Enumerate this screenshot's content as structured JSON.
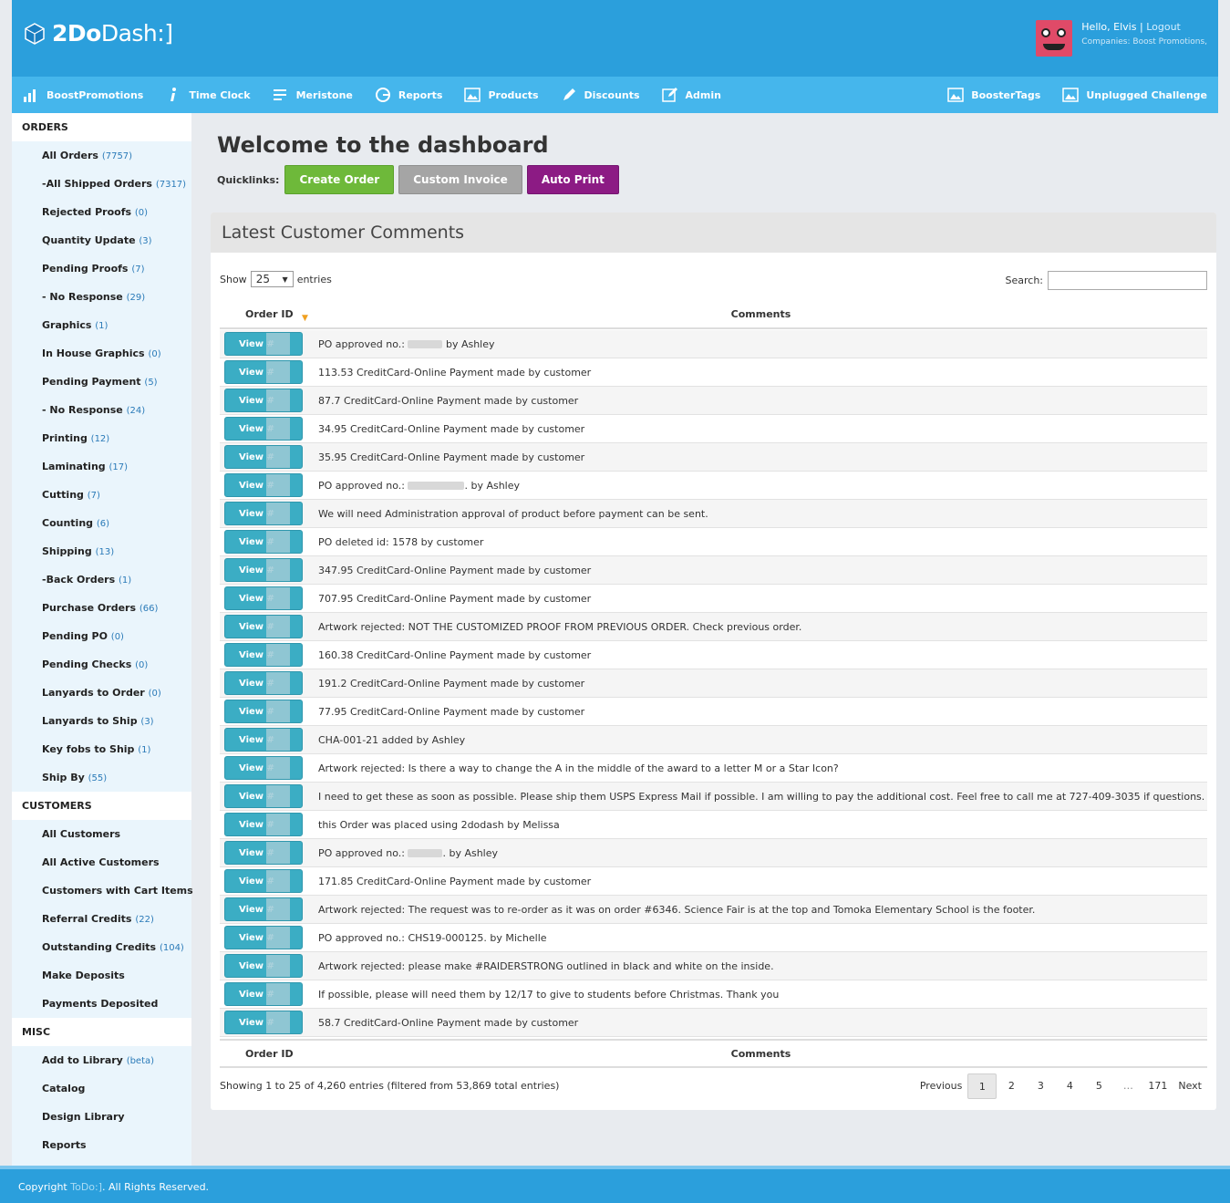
{
  "brand": {
    "name_bold": "2Do",
    "name_light": "Dash:]"
  },
  "user": {
    "greeting": "Hello, Elvis",
    "separator": "|",
    "logout": "Logout",
    "companies": "Companies: Boost Promotions,"
  },
  "nav": [
    {
      "label": "BoostPromotions",
      "icon": "bar-chart-icon"
    },
    {
      "label": "Time Clock",
      "icon": "info-icon"
    },
    {
      "label": "Meristone",
      "icon": "list-icon"
    },
    {
      "label": "Reports",
      "icon": "reports-icon"
    },
    {
      "label": "Products",
      "icon": "image-icon"
    },
    {
      "label": "Discounts",
      "icon": "pen-icon"
    },
    {
      "label": "Admin",
      "icon": "edit-icon"
    }
  ],
  "nav_right": [
    {
      "label": "BoosterTags",
      "icon": "image-icon"
    },
    {
      "label": "Unplugged Challenge",
      "icon": "image-icon"
    }
  ],
  "sidebar": {
    "orders_title": "ORDERS",
    "orders": [
      {
        "label": "All Orders",
        "count": "(7757)"
      },
      {
        "label": "-All Shipped Orders",
        "count": "(7317)"
      },
      {
        "label": "Rejected Proofs",
        "count": "(0)"
      },
      {
        "label": "Quantity Update",
        "count": "(3)"
      },
      {
        "label": "Pending Proofs",
        "count": "(7)"
      },
      {
        "label": "- No Response",
        "count": "(29)"
      },
      {
        "label": "Graphics",
        "count": "(1)"
      },
      {
        "label": "In House Graphics",
        "count": "(0)"
      },
      {
        "label": "Pending Payment",
        "count": "(5)"
      },
      {
        "label": "- No Response",
        "count": "(24)"
      },
      {
        "label": "Printing",
        "count": "(12)"
      },
      {
        "label": "Laminating",
        "count": "(17)"
      },
      {
        "label": "Cutting",
        "count": "(7)"
      },
      {
        "label": "Counting",
        "count": "(6)"
      },
      {
        "label": "Shipping",
        "count": "(13)"
      },
      {
        "label": "-Back Orders",
        "count": "(1)"
      },
      {
        "label": "Purchase Orders",
        "count": "(66)"
      },
      {
        "label": "Pending PO",
        "count": "(0)"
      },
      {
        "label": "Pending Checks",
        "count": "(0)"
      },
      {
        "label": "Lanyards to Order",
        "count": "(0)"
      },
      {
        "label": "Lanyards to Ship",
        "count": "(3)"
      },
      {
        "label": "Key fobs to Ship",
        "count": "(1)"
      },
      {
        "label": "Ship By",
        "count": "(55)"
      }
    ],
    "customers_title": "CUSTOMERS",
    "customers": [
      {
        "label": "All Customers",
        "count": ""
      },
      {
        "label": "All Active Customers",
        "count": ""
      },
      {
        "label": "Customers with Cart Items",
        "count": ""
      },
      {
        "label": "Referral Credits",
        "count": "(22)"
      },
      {
        "label": "Outstanding Credits",
        "count": "(104)"
      },
      {
        "label": "Make Deposits",
        "count": ""
      },
      {
        "label": "Payments Deposited",
        "count": ""
      }
    ],
    "misc_title": "MISC",
    "misc": [
      {
        "label": "Add to Library",
        "count": "(beta)"
      },
      {
        "label": "Catalog",
        "count": ""
      },
      {
        "label": "Design Library",
        "count": ""
      },
      {
        "label": "Reports",
        "count": ""
      }
    ]
  },
  "main": {
    "title": "Welcome to the dashboard",
    "quicklinks_label": "Quicklinks:",
    "quicklinks": {
      "create": "Create Order",
      "invoice": "Custom Invoice",
      "print": "Auto Print"
    }
  },
  "comments_panel": {
    "title": "Latest Customer Comments",
    "show_label": "Show",
    "show_value": "25",
    "entries_label": "entries",
    "search_label": "Search:",
    "search_value": "",
    "col_order": "Order ID",
    "col_comments": "Comments",
    "view_label": "View #",
    "rows": [
      {
        "pre": "PO approved no.: ",
        "redact": 38,
        "post": " by Ashley"
      },
      {
        "pre": "113.53 CreditCard-Online Payment made by customer"
      },
      {
        "pre": "87.7 CreditCard-Online Payment made by customer"
      },
      {
        "pre": "34.95 CreditCard-Online Payment made by customer"
      },
      {
        "pre": "35.95 CreditCard-Online Payment made by customer"
      },
      {
        "pre": "PO approved no.: ",
        "redact": 62,
        "post": ". by Ashley"
      },
      {
        "pre": "We will need Administration approval of product before payment can be sent."
      },
      {
        "pre": "PO deleted id: 1578 by customer"
      },
      {
        "pre": "347.95 CreditCard-Online Payment made by customer"
      },
      {
        "pre": "707.95 CreditCard-Online Payment made by customer"
      },
      {
        "pre": "Artwork rejected: NOT THE CUSTOMIZED PROOF FROM PREVIOUS ORDER. Check previous order."
      },
      {
        "pre": "160.38 CreditCard-Online Payment made by customer"
      },
      {
        "pre": "191.2 CreditCard-Online Payment made by customer"
      },
      {
        "pre": "77.95 CreditCard-Online Payment made by customer"
      },
      {
        "pre": "CHA-001-21 added by Ashley"
      },
      {
        "pre": "Artwork rejected: Is there a way to change the A in the middle of the award to a letter M or a Star Icon?"
      },
      {
        "pre": "I need to get these as soon as possible. Please ship them USPS Express Mail if possible. I am willing to pay the additional cost. Feel free to call me at 727-409-3035 if questions."
      },
      {
        "pre": "this Order was placed using 2dodash by Melissa"
      },
      {
        "pre": "PO approved no.: ",
        "redact": 38,
        "post": ". by Ashley"
      },
      {
        "pre": "171.85 CreditCard-Online Payment made by customer"
      },
      {
        "pre": "Artwork rejected: The request was to re-order as it was on order #6346. Science Fair is at the top and Tomoka Elementary School is the footer."
      },
      {
        "pre": "PO approved no.: CHS19-000125. by Michelle"
      },
      {
        "pre": "Artwork rejected: please make #RAIDERSTRONG outlined in black and white on the inside."
      },
      {
        "pre": "If possible, please will need them by 12/17 to give to students before Christmas. Thank you"
      },
      {
        "pre": "58.7 CreditCard-Online Payment made by customer"
      }
    ],
    "info": "Showing 1 to 25 of 4,260 entries (filtered from 53,869 total entries)",
    "pagination": {
      "previous": "Previous",
      "pages": [
        "1",
        "2",
        "3",
        "4",
        "5"
      ],
      "ellipsis": "…",
      "last": "171",
      "next": "Next"
    }
  },
  "footer": {
    "pre": "Copyright ",
    "brand": "ToDo:]",
    "post": ". All Rights Reserved."
  },
  "colors": {
    "header": "#2b9fdc",
    "nav": "#45b6ec",
    "view_button": "#3badc4",
    "green": "#6eb93a",
    "gray": "#a5a5a5",
    "purple": "#8c1b84"
  }
}
